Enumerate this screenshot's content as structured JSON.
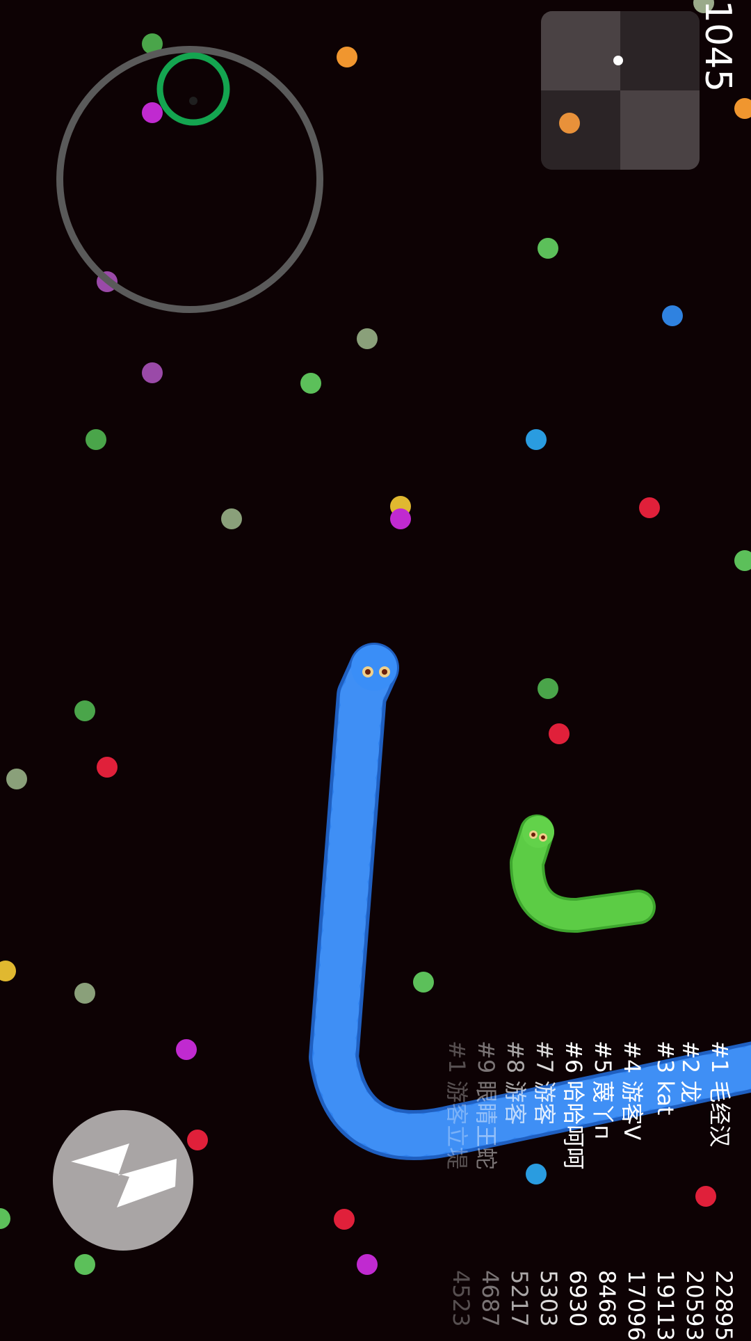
{
  "hud": {
    "score": "1045"
  },
  "colors": {
    "background": "#0d0204",
    "player_snake": "#2f82f0",
    "enemy_snake": "#5ccc45",
    "joystick_ring": "#5a5a5a",
    "joystick_knob": "#14a550"
  },
  "icons": {
    "boost": "lightning-bolt-icon"
  },
  "leaderboard": [
    {
      "name": "#1 毛经汉",
      "score": "22895"
    },
    {
      "name": "#2 龙",
      "score": "20593"
    },
    {
      "name": "#3 kat",
      "score": "19113"
    },
    {
      "name": "#4 游客V",
      "score": "17096"
    },
    {
      "name": "#5 蔑丫п",
      "score": "8468"
    },
    {
      "name": "#6 哈哈呵呵",
      "score": "6930"
    },
    {
      "name": "#7 游客",
      "score": "5303"
    },
    {
      "name": "#8 游客",
      "score": "5217"
    },
    {
      "name": "#9 眼睛王蛇",
      "score": "4687"
    },
    {
      "name": "#1 游客立堤",
      "score": "4523"
    }
  ]
}
